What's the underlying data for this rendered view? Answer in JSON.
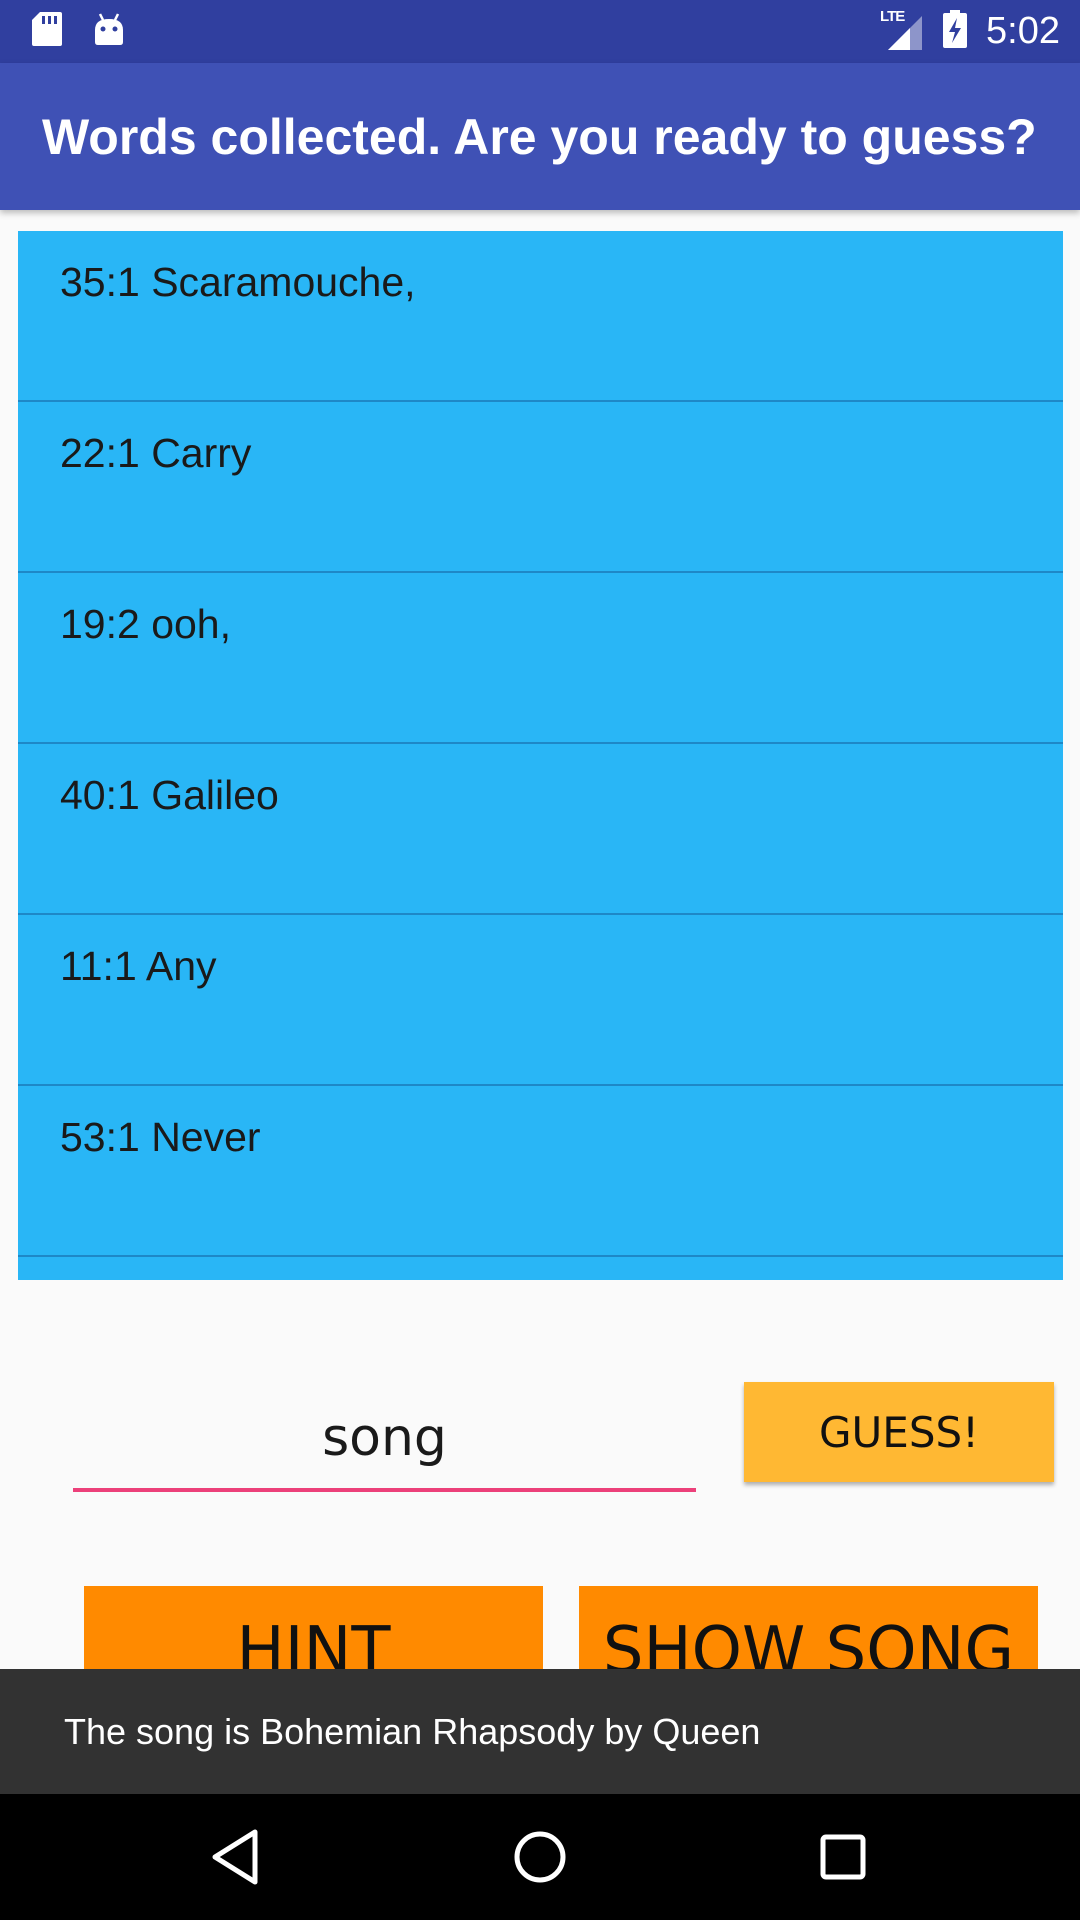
{
  "status_bar": {
    "time": "5:02",
    "network_label": "LTE",
    "icons": [
      "sd-card-icon",
      "android-icon",
      "signal-icon",
      "battery-charging-icon"
    ]
  },
  "app_bar": {
    "title": "Words collected. Are you ready to guess?"
  },
  "words": [
    {
      "label": "35:1 Scaramouche,"
    },
    {
      "label": "22:1 Carry"
    },
    {
      "label": "19:2 ooh,"
    },
    {
      "label": "40:1 Galileo"
    },
    {
      "label": "11:1 Any"
    },
    {
      "label": "53:1 Never"
    },
    {
      "label": ""
    }
  ],
  "guess": {
    "input_value": "song",
    "button_label": "GUESS!"
  },
  "actions": {
    "hint_label": "HINT",
    "show_song_label": "SHOW SONG"
  },
  "snackbar": {
    "message": "The song is Bohemian Rhapsody by Queen"
  },
  "colors": {
    "status_bar": "#303f9f",
    "app_bar": "#3f51b5",
    "list_background": "#29b6f6",
    "input_underline": "#ec407a",
    "guess_button": "#ffb833",
    "action_button": "#ff8a00",
    "snackbar": "#323232"
  }
}
